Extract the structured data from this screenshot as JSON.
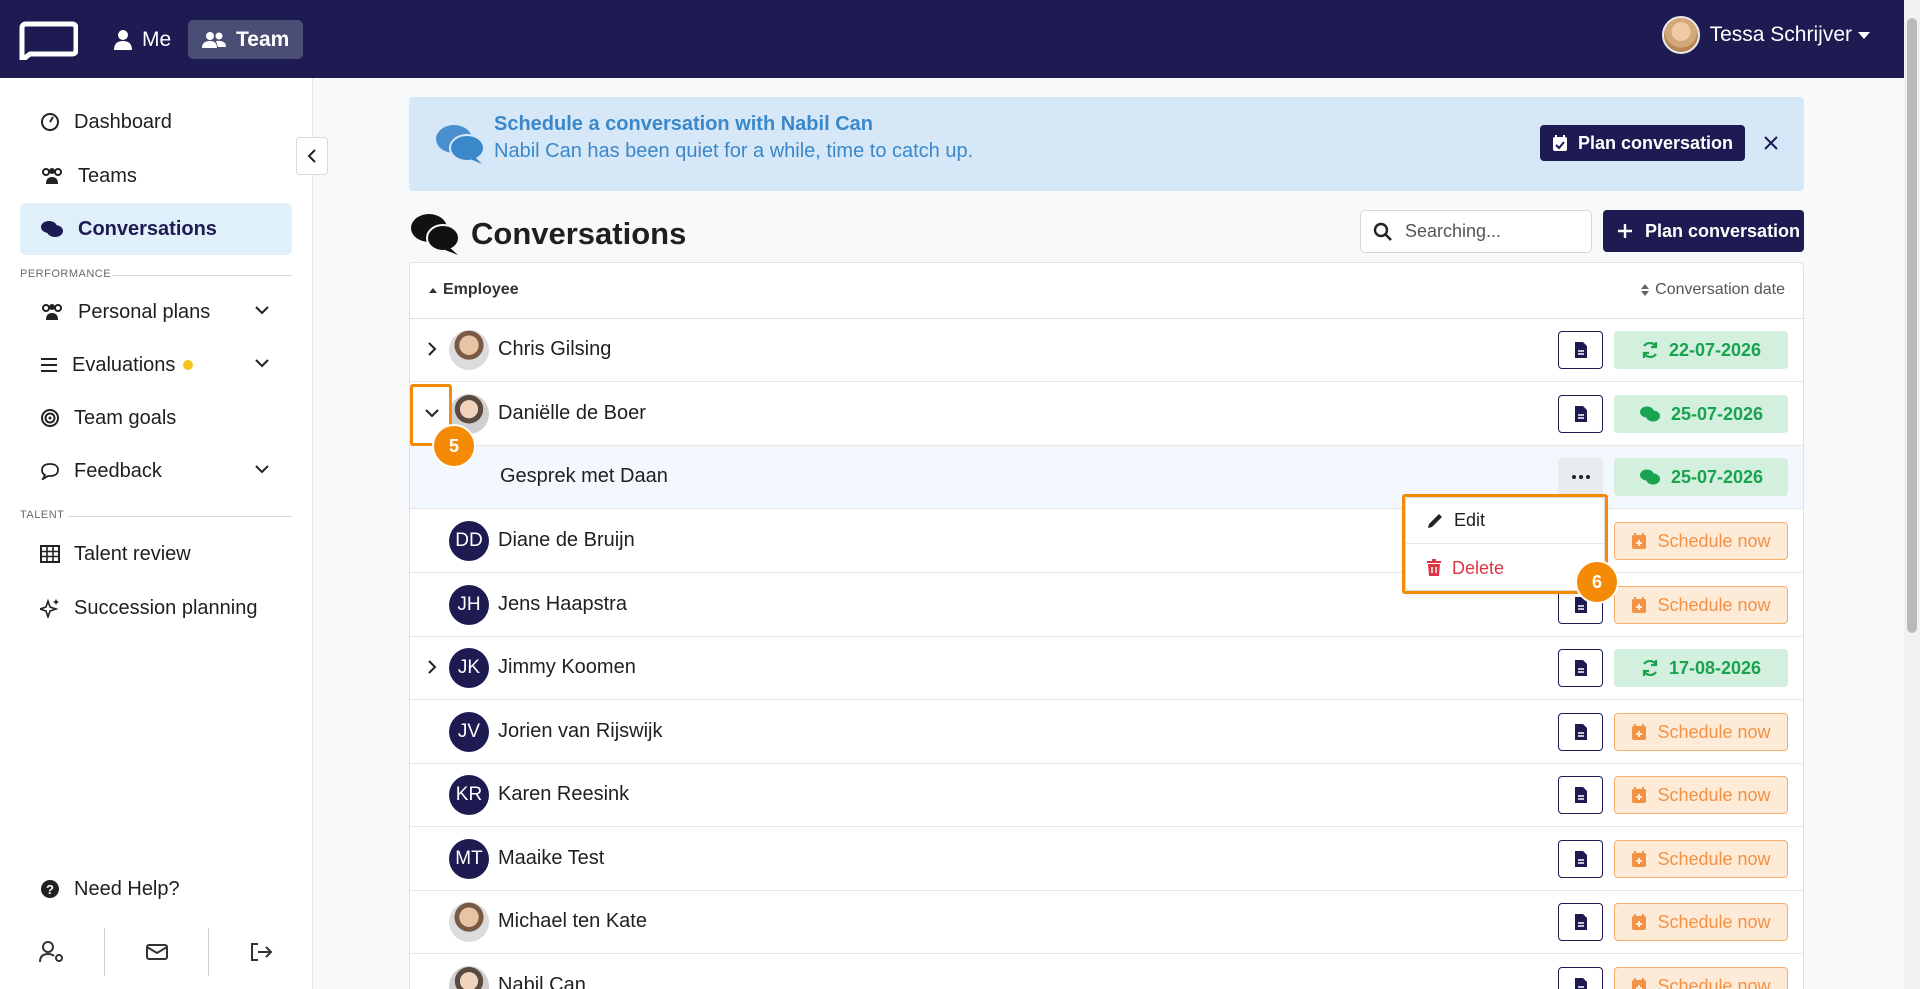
{
  "topbar": {
    "nav": [
      {
        "label": "Me",
        "icon": "user-icon"
      },
      {
        "label": "Team",
        "icon": "users-icon"
      }
    ],
    "user_name": "Tessa Schrijver"
  },
  "sidebar": {
    "items": [
      {
        "label": "Dashboard",
        "icon": "gauge-icon"
      },
      {
        "label": "Teams",
        "icon": "users-icon"
      },
      {
        "label": "Conversations",
        "icon": "comments-icon",
        "active": true
      },
      {
        "label": "Personal plans",
        "icon": "users-icon"
      },
      {
        "label": "Evaluations",
        "icon": "list-icon"
      },
      {
        "label": "Team goals",
        "icon": "target-icon"
      },
      {
        "label": "Feedback",
        "icon": "comment-icon"
      },
      {
        "label": "Talent review",
        "icon": "grid-icon"
      },
      {
        "label": "Succession planning",
        "icon": "sparkles-icon"
      }
    ],
    "sections": {
      "performance": "PERFORMANCE",
      "talent": "TALENT"
    },
    "help": "Need Help?"
  },
  "alert": {
    "title": "Schedule a conversation with Nabil Can",
    "text": "Nabil Can has been quiet for a while, time to catch up.",
    "button": "Plan conversation"
  },
  "page": {
    "title": "Conversations",
    "search_placeholder": "Searching...",
    "plan_button": "Plan conversation"
  },
  "table": {
    "col_employee": "Employee",
    "col_date": "Conversation date",
    "rows": [
      {
        "name": "Chris Gilsing",
        "initials": "",
        "status": "22-07-2026",
        "kind": "recurring"
      },
      {
        "name": "Daniëlle de Boer",
        "initials": "",
        "status": "25-07-2026",
        "kind": "conversation"
      },
      {
        "name": "Gesprek met Daan",
        "status": "25-07-2026",
        "kind": "conversation",
        "sub": true
      },
      {
        "name": "Diane de Bruijn",
        "initials": "DD",
        "status": "Schedule now",
        "kind": "schedule"
      },
      {
        "name": "Jens Haapstra",
        "initials": "JH",
        "status": "Schedule now",
        "kind": "schedule"
      },
      {
        "name": "Jimmy Koomen",
        "initials": "JK",
        "status": "17-08-2026",
        "kind": "recurring"
      },
      {
        "name": "Jorien van Rijswijk",
        "initials": "JV",
        "status": "Schedule now",
        "kind": "schedule"
      },
      {
        "name": "Karen Reesink",
        "initials": "KR",
        "status": "Schedule now",
        "kind": "schedule"
      },
      {
        "name": "Maaike Test",
        "initials": "MT",
        "status": "Schedule now",
        "kind": "schedule"
      },
      {
        "name": "Michael ten Kate",
        "initials": "",
        "status": "Schedule now",
        "kind": "schedule"
      },
      {
        "name": "Nabil Can",
        "initials": "",
        "status": "Schedule now",
        "kind": "schedule"
      }
    ]
  },
  "dropdown": {
    "edit": "Edit",
    "delete": "Delete"
  },
  "steps": {
    "five": "5",
    "six": "6"
  },
  "colors": {
    "navy": "#1d1b52",
    "green": "#19a34f",
    "orange": "#f39144",
    "highlight": "#f58a07",
    "danger": "#dc3545"
  }
}
